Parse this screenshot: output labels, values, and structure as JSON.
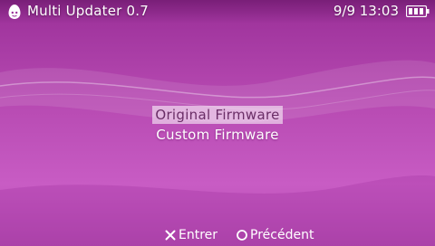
{
  "header": {
    "app_icon": "egg-icon",
    "app_title": "Multi Updater 0.7",
    "clock": "9/9 13:03",
    "battery_icon": "battery-icon"
  },
  "menu": {
    "items": [
      {
        "label": "Original Firmware",
        "selected": true
      },
      {
        "label": "Custom Firmware",
        "selected": false
      }
    ]
  },
  "footer": {
    "enter": {
      "icon": "cross-button-icon",
      "label": "Entrer"
    },
    "back": {
      "icon": "circle-button-icon",
      "label": "Précédent"
    }
  },
  "colors": {
    "background": "#b649b1",
    "selection_highlight": "#e7c1e4",
    "text": "#ffffff"
  }
}
